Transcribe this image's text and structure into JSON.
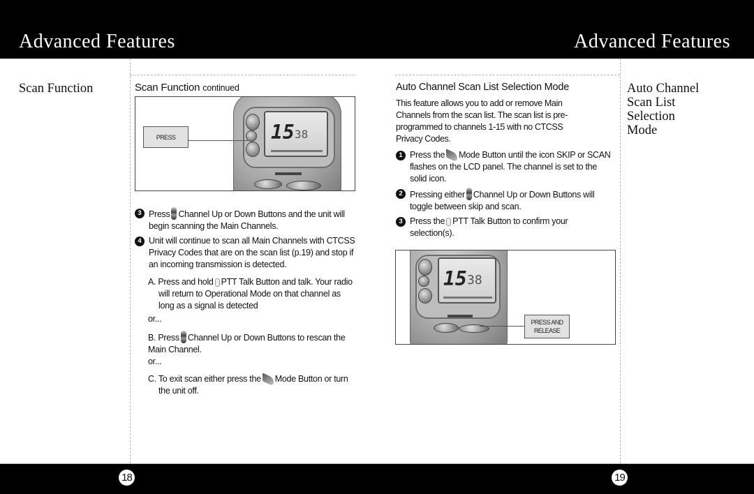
{
  "header": {
    "left_title": "Advanced Features",
    "right_title": "Advanced Features"
  },
  "left_page": {
    "side_title": [
      "Scan Function"
    ],
    "section_title": "Scan Function",
    "section_title_suffix": "continued",
    "figure": {
      "callout": "PRESS",
      "lcd_channel": "15",
      "lcd_code": "38"
    },
    "steps": [
      {
        "number": "3",
        "before_icon": "Press",
        "icon": "channel-button-icon",
        "after_icon": "Channel Up or Down Buttons and the unit will begin scanning the Main Channels."
      },
      {
        "number": "4",
        "text": "Unit will continue to scan all Main Channels with CTCSS Privacy Codes that are on the scan list (p.19) and stop if an incoming transmission is detected."
      }
    ],
    "options": {
      "a": {
        "before_icon": "A. Press and hold",
        "icon": "ptt-button-icon",
        "after_icon": "PTT Talk Button and talk. Your radio will return to Operational Mode on that channel as long as a signal is detected"
      },
      "or_1": "or...",
      "b": {
        "before_icon": "B. Press",
        "icon": "channel-button-icon",
        "after_icon": "Channel Up or Down Buttons to rescan the Main Channel."
      },
      "or_2": "or...",
      "c": {
        "before_icon": "C. To exit scan either press the",
        "icon": "mode-button-icon",
        "after_icon": "Mode Button or turn the unit off."
      }
    },
    "page_number": "18"
  },
  "right_page": {
    "side_title": [
      "Auto Channel",
      "Scan List",
      "Selection",
      "Mode"
    ],
    "section_title": "Auto Channel Scan List Selection Mode",
    "intro": "This feature allows you to add or remove Main Channels from the scan list. The scan list is pre-programmed to channels 1-15 with no CTCSS Privacy Codes.",
    "steps": [
      {
        "number": "1",
        "before_icon": "Press the",
        "icon": "mode-button-icon",
        "after_icon": "Mode Button until the icon SKIP or SCAN flashes on the LCD panel. The channel is set to the solid icon."
      },
      {
        "number": "2",
        "before_icon": "Pressing either",
        "icon": "channel-button-icon",
        "after_icon": "Channel Up or Down Buttons will toggle between skip and scan."
      },
      {
        "number": "3",
        "before_icon": "Press the",
        "icon": "ptt-button-icon",
        "after_icon": "PTT Talk Button to confirm your selection(s)."
      }
    ],
    "figure": {
      "callout_line1": "PRESS AND",
      "callout_line2": "RELEASE",
      "lcd_channel": "15",
      "lcd_code": "38"
    },
    "page_number": "19"
  }
}
